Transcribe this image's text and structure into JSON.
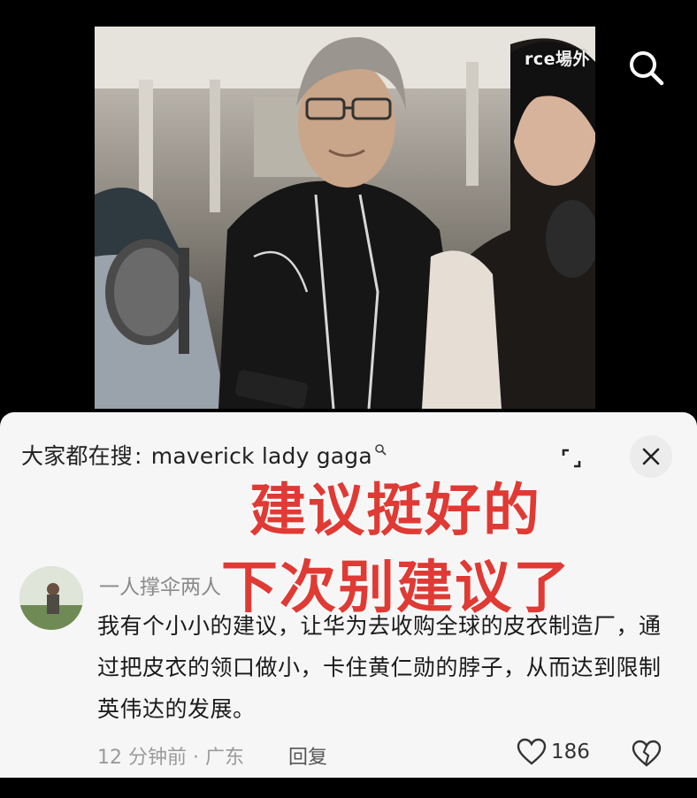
{
  "video": {
    "watermark": "rce場外"
  },
  "panel": {
    "trending_label": "大家都在搜",
    "trending_sep": ":",
    "trending_query": "maverick lady gaga"
  },
  "overlay": {
    "line1": "建议挺好的",
    "line2": "下次别建议了"
  },
  "comment": {
    "username": "一人撑伞两人",
    "text": "我有个小小的建议，让华为去收购全球的皮衣制造厂，通过把皮衣的领口做小，卡住黄仁勋的脖子，从而达到限制英伟达的发展。",
    "meta": "12 分钟前 · 广东",
    "reply_label": "回复",
    "like_count": "186"
  },
  "colors": {
    "overlay_red": "#e03a34",
    "panel_bg": "#f6f6f6"
  }
}
